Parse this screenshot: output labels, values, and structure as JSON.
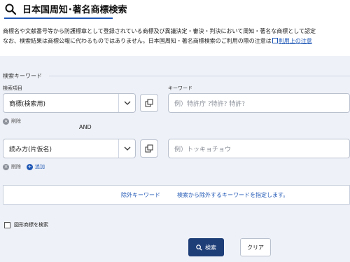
{
  "header": {
    "title": "日本国周知･著名商標検索",
    "icon": "search-icon"
  },
  "description": {
    "line1": "商標名や文献番号等から防護標章として登録されている商標及び異議決定・審決・判決において周知・著名な商標として認定",
    "line2": "なお、検索結果は商標公報に代わるものではありません。日本国周知・著名商標検索のご利用の際の注意は",
    "link": "利用上の注意"
  },
  "keyword_section": {
    "heading": "検索キーワード",
    "item_label": "検索項目",
    "keyword_label": "キーワード"
  },
  "rows": [
    {
      "field": "商標(検索用)",
      "placeholder": "例）特許庁 ?特許? 特許?",
      "delete_label": "削除"
    },
    {
      "field": "読み方(片仮名)",
      "placeholder": "例）トッキョチョウ",
      "delete_label": "削除",
      "add_label": "追加"
    }
  ],
  "and_label": "AND",
  "exclude": {
    "label": "除外キーワード",
    "hint": "検索から除外するキーワードを指定します。"
  },
  "figure_checkbox": {
    "label": "図形商標を検索",
    "checked": false
  },
  "buttons": {
    "search": "検索",
    "clear": "クリア"
  },
  "colors": {
    "accent": "#1f57b5",
    "search_button": "#1e3e78",
    "background": "#eef1f7"
  }
}
